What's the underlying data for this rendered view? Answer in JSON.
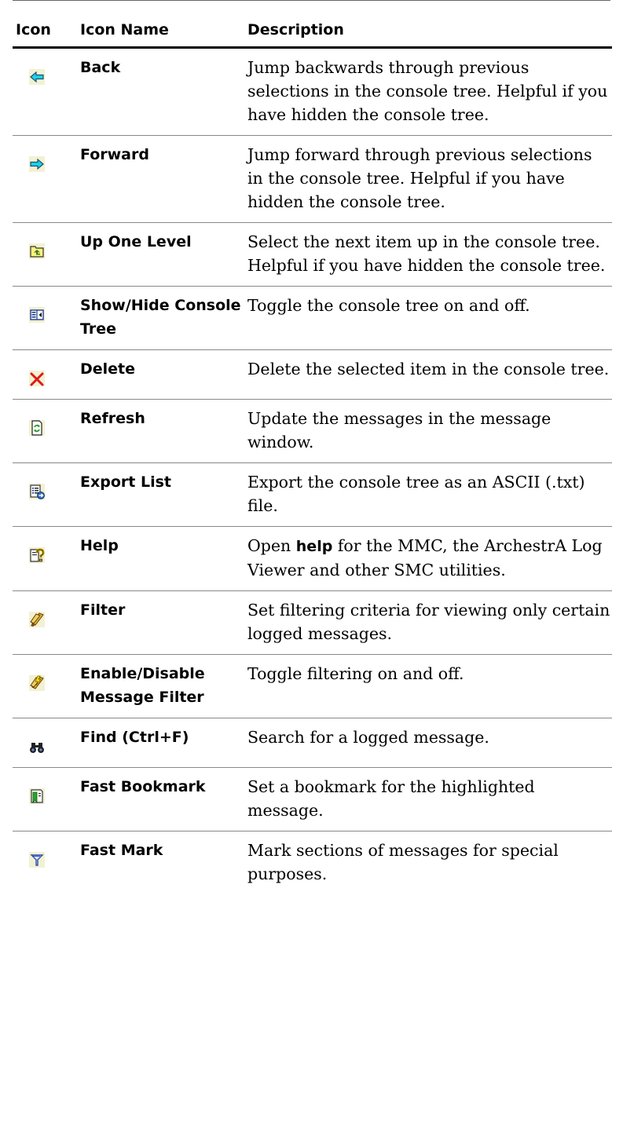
{
  "header": {
    "col_icon": "Icon",
    "col_name": "Icon Name",
    "col_desc": "Description"
  },
  "rows": [
    {
      "icon": "back-arrow-icon",
      "name": "Back",
      "desc": "Jump backwards through previous selections in the console tree. Helpful if you have hidden the console tree."
    },
    {
      "icon": "forward-arrow-icon",
      "name": "Forward",
      "desc": "Jump forward through previous selections in the console tree. Helpful if you have hidden the console tree."
    },
    {
      "icon": "up-one-level-folder-icon",
      "name": "Up One Level",
      "desc": "Select the next item up in the console tree. Helpful if you have hidden the console tree."
    },
    {
      "icon": "show-hide-tree-icon",
      "name": "Show/Hide Console Tree",
      "desc": "Toggle the console tree on and off."
    },
    {
      "icon": "delete-x-icon",
      "name": "Delete",
      "desc": "Delete the selected item in the console tree."
    },
    {
      "icon": "refresh-icon",
      "name": "Refresh",
      "desc": "Update the messages in the message window."
    },
    {
      "icon": "export-list-icon",
      "name": "Export List",
      "desc": "Export the console tree as an ASCII (.txt) file."
    },
    {
      "icon": "help-icon",
      "name": "Help",
      "desc_pre": "Open ",
      "desc_bold": "help",
      "desc_post": " for the MMC, the ArchestrA Log Viewer and other SMC utilities."
    },
    {
      "icon": "filter-icon",
      "name": "Filter",
      "desc": "Set filtering criteria for viewing only certain logged messages."
    },
    {
      "icon": "enable-disable-filter-icon",
      "name": "Enable/Disable Message Filter",
      "desc": "Toggle filtering on and off."
    },
    {
      "icon": "binoculars-find-icon",
      "name": "Find (Ctrl+F)",
      "desc": "Search for a logged message."
    },
    {
      "icon": "fast-bookmark-icon",
      "name": "Fast Bookmark",
      "desc": "Set a bookmark for the highlighted message."
    },
    {
      "icon": "fast-mark-flag-icon",
      "name": "Fast Mark",
      "desc": "Mark sections of messages for special purposes."
    }
  ]
}
